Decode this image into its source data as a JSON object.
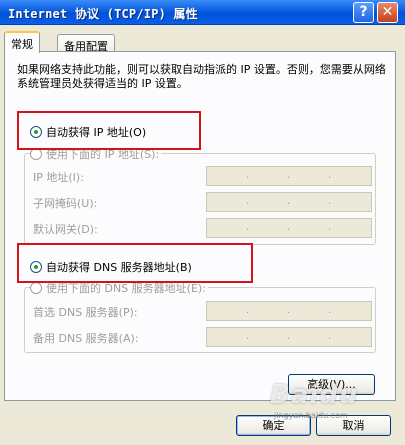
{
  "window": {
    "title": "Internet 协议 (TCP/IP) 属性",
    "help_label": "?",
    "close_label": "✕"
  },
  "tabs": [
    {
      "label": "常规",
      "active": true
    },
    {
      "label": "备用配置",
      "active": false
    }
  ],
  "intro": "如果网络支持此功能，则可以获取自动指派的 IP 设置。否则，您需要从网络系统管理员处获得适当的 IP 设置。",
  "ip_section": {
    "auto_label": "自动获得 IP 地址(O)",
    "auto_selected": true,
    "manual_label": "使用下面的 IP 地址(S):",
    "fields": [
      {
        "label": "IP 地址(I):"
      },
      {
        "label": "子网掩码(U):"
      },
      {
        "label": "默认网关(D):"
      }
    ]
  },
  "dns_section": {
    "auto_label": "自动获得 DNS 服务器地址(B)",
    "auto_selected": true,
    "manual_label": "使用下面的 DNS 服务器地址(E):",
    "fields": [
      {
        "label": "首选 DNS 服务器(P):"
      },
      {
        "label": "备用 DNS 服务器(A):"
      }
    ]
  },
  "buttons": {
    "advanced": "高级(V)...",
    "ok": "确定",
    "cancel": "取消"
  },
  "watermark": {
    "text": "Baidu",
    "sub": "jingyan.baidu.com"
  },
  "colors": {
    "highlight": "#d3121b",
    "title_bar": "#0a5ee0",
    "dialog_bg": "#ece9d8"
  }
}
